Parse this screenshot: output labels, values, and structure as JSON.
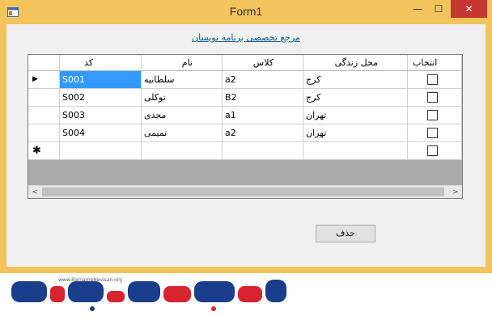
{
  "window": {
    "title": "Form1",
    "minimize_glyph": "—",
    "maximize_glyph": "☐",
    "close_glyph": "✕"
  },
  "form": {
    "link_text": "مرجع تخصصی برنامه نویسان",
    "delete_button_label": "حذف"
  },
  "grid": {
    "columns": [
      "کد",
      "نام",
      "کلاس",
      "محل زندگی",
      "انتخاب"
    ],
    "rows": [
      {
        "code": "S001",
        "name": "سلطانیه",
        "class": "a2",
        "city": "کرج",
        "checked": false,
        "current": true
      },
      {
        "code": "S002",
        "name": "توکلی",
        "class": "B2",
        "city": "کرج",
        "checked": false,
        "current": false
      },
      {
        "code": "S003",
        "name": "محدی",
        "class": "a1",
        "city": "تهران",
        "checked": false,
        "current": false
      },
      {
        "code": "S004",
        "name": "تمیمی",
        "class": "a2",
        "city": "تهران",
        "checked": false,
        "current": false
      }
    ],
    "current_row_glyph": "▶",
    "new_row_glyph": "✱",
    "scroll_left_glyph": "<",
    "scroll_right_glyph": ">"
  },
  "banner": {
    "url_text": "www.BarnameNevisan.org",
    "logo_text": "برنامه نویسان",
    "colors": {
      "blue": "#1a3e8c",
      "red": "#d9232e"
    }
  },
  "colors": {
    "window_frame": "#f3c45c",
    "close_button": "#c7372f",
    "selection": "#3399ff",
    "grid_empty_area": "#ababab"
  }
}
